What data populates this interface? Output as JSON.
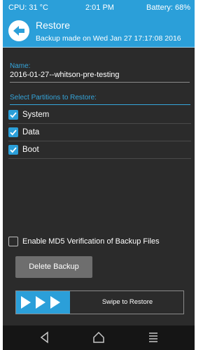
{
  "status_bar": {
    "cpu": "CPU: 31 °C",
    "time": "2:01 PM",
    "battery": "Battery: 68%"
  },
  "header": {
    "back_icon": "back-arrow-icon",
    "title": "Restore",
    "subtitle": "Backup made on Wed Jan 27 17:17:08 2016"
  },
  "name_field": {
    "label": "Name:",
    "value": "2016-01-27--whitson-pre-testing"
  },
  "partitions": {
    "label": "Select Partitions to Restore:",
    "items": [
      {
        "label": "System",
        "checked": true
      },
      {
        "label": "Data",
        "checked": true
      },
      {
        "label": "Boot",
        "checked": true
      }
    ]
  },
  "md5_option": {
    "label": "Enable MD5 Verification of Backup Files",
    "checked": false
  },
  "delete_button": {
    "label": "Delete Backup"
  },
  "swipe": {
    "label": "Swipe to Restore",
    "icon": "triple-arrow-icon"
  },
  "nav": {
    "back_icon": "nav-back-icon",
    "home_icon": "nav-home-icon",
    "menu_icon": "nav-menu-icon"
  },
  "colors": {
    "accent": "#2b9fd9",
    "background": "#2b2b2b",
    "button": "#6e6e6e",
    "navbar": "#151515"
  }
}
